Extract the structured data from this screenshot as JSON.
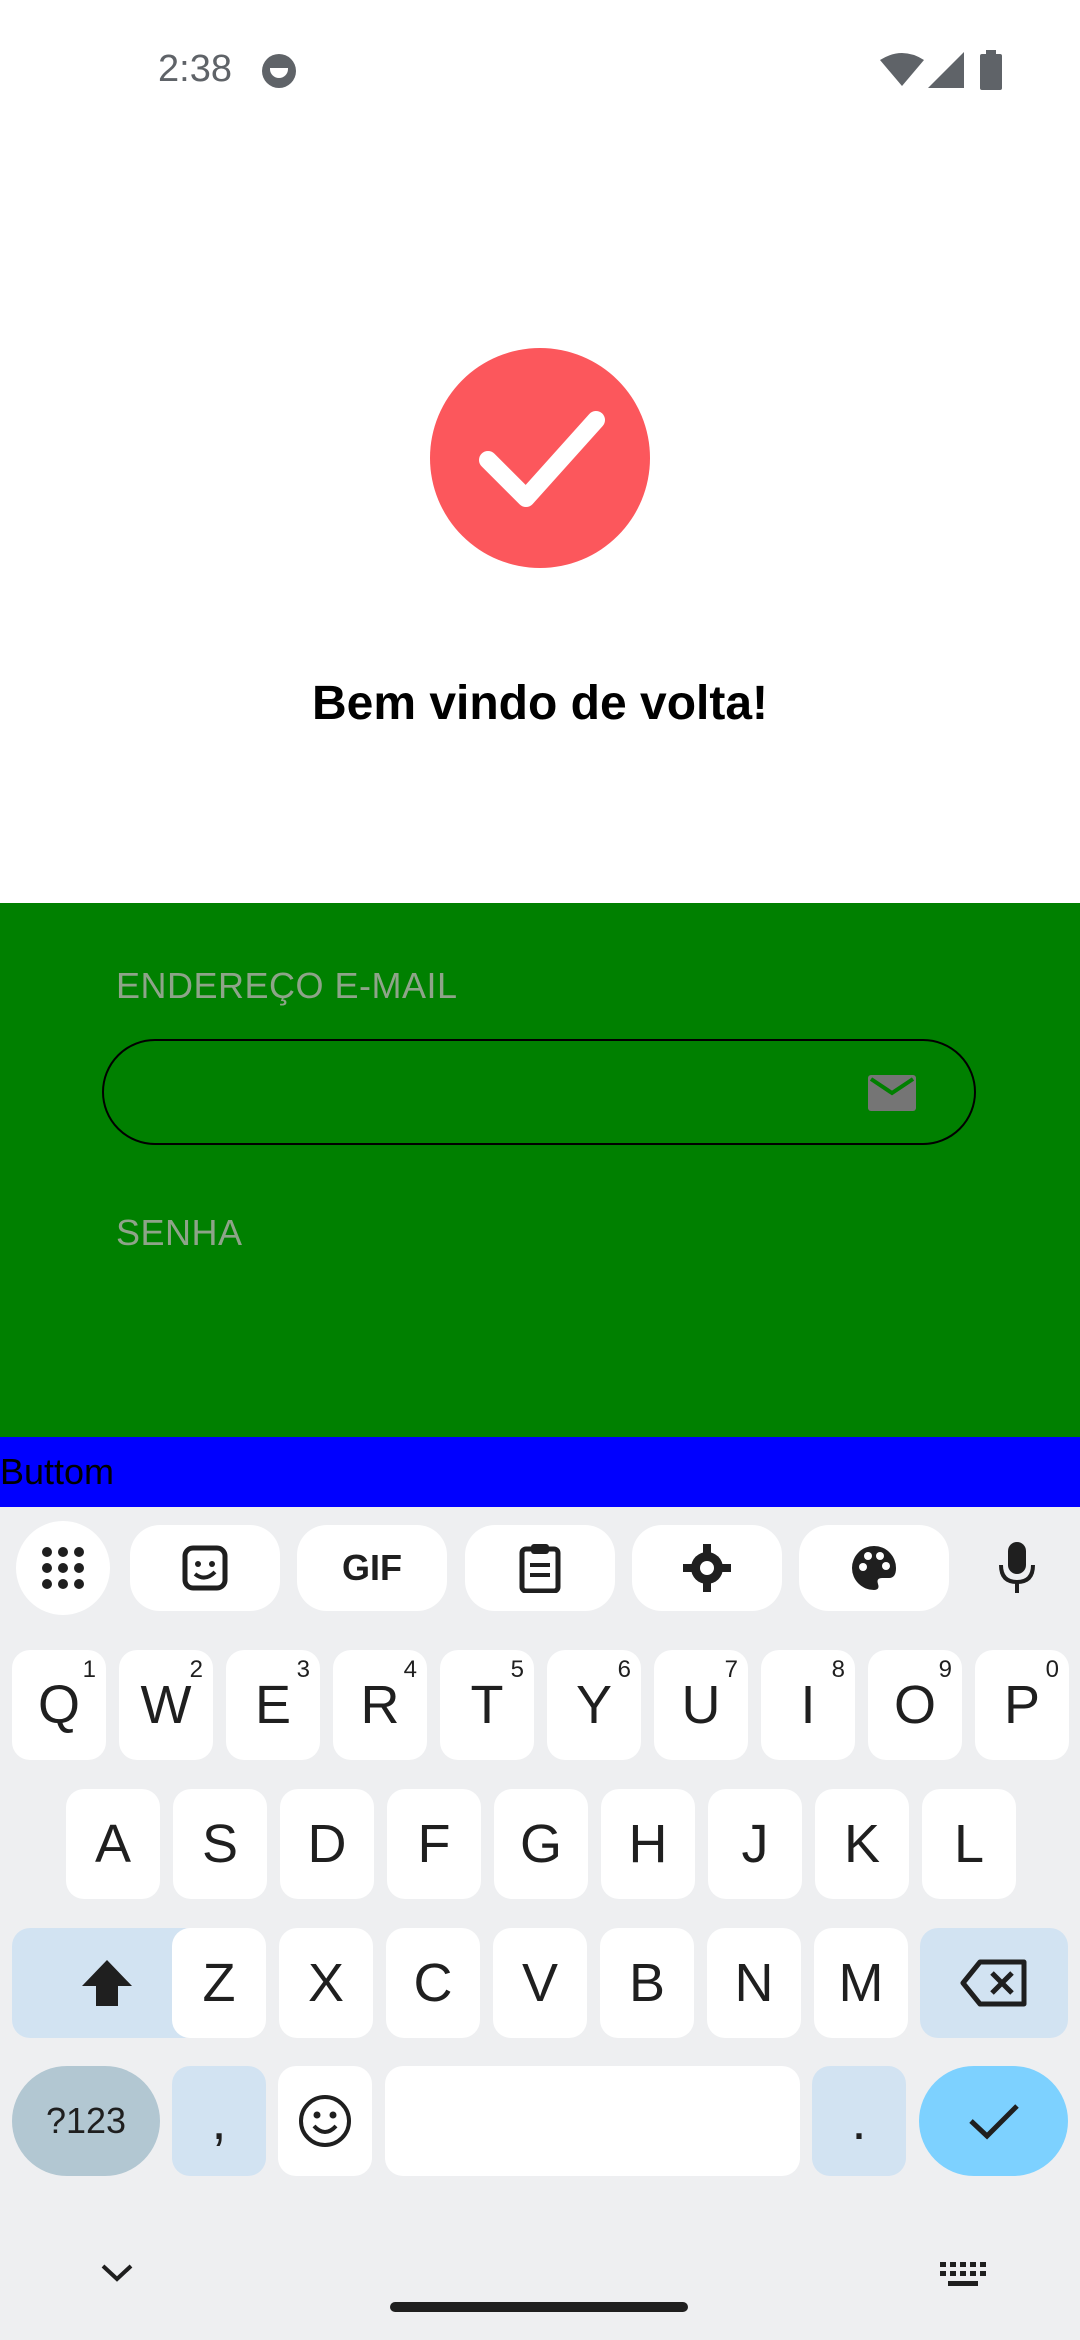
{
  "status_bar": {
    "time": "2:38",
    "icons": [
      "face-status-icon",
      "wifi-icon",
      "signal-icon",
      "battery-icon"
    ]
  },
  "app": {
    "welcome_text": "Bem vindo de volta!",
    "email_label": "ENDEREÇO E-MAIL",
    "email_value": "",
    "password_label": "SENHA",
    "bottom_button_label": "Buttom",
    "colors": {
      "logo": "#fc575c",
      "form_background": "#008000",
      "button_background": "#0000ff"
    }
  },
  "keyboard": {
    "toolbar": [
      "apps-grid-icon",
      "sticker-icon",
      "gif-button",
      "clipboard-icon",
      "settings-gear-icon",
      "palette-icon",
      "microphone-icon"
    ],
    "gif_label": "GIF",
    "row1": [
      {
        "key": "Q",
        "hint": "1"
      },
      {
        "key": "W",
        "hint": "2"
      },
      {
        "key": "E",
        "hint": "3"
      },
      {
        "key": "R",
        "hint": "4"
      },
      {
        "key": "T",
        "hint": "5"
      },
      {
        "key": "Y",
        "hint": "6"
      },
      {
        "key": "U",
        "hint": "7"
      },
      {
        "key": "I",
        "hint": "8"
      },
      {
        "key": "O",
        "hint": "9"
      },
      {
        "key": "P",
        "hint": "0"
      }
    ],
    "row2": [
      "A",
      "S",
      "D",
      "F",
      "G",
      "H",
      "J",
      "K",
      "L"
    ],
    "row3": [
      "Z",
      "X",
      "C",
      "V",
      "B",
      "N",
      "M"
    ],
    "symbols_label": "?123",
    "comma_label": ",",
    "period_label": "."
  }
}
